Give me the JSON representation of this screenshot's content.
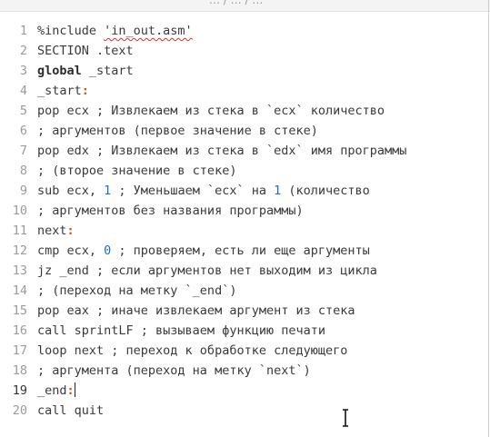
{
  "window": {
    "title_fragment": "… / … / …"
  },
  "editor": {
    "current_line": 19,
    "lines": [
      {
        "n": "1",
        "parts": [
          {
            "t": "%include ",
            "c": ""
          },
          {
            "t": "'in_out.asm'",
            "c": "str-under"
          }
        ]
      },
      {
        "n": "2",
        "parts": [
          {
            "t": "SECTION .text",
            "c": ""
          }
        ]
      },
      {
        "n": "3",
        "parts": [
          {
            "t": "global",
            "c": "kw"
          },
          {
            "t": " _start",
            "c": ""
          }
        ]
      },
      {
        "n": "4",
        "parts": [
          {
            "t": "_start",
            "c": ""
          },
          {
            "t": ":",
            "c": "lbl"
          }
        ]
      },
      {
        "n": "5",
        "parts": [
          {
            "t": "pop ecx ; Извлекаем из стека в `ecx` количество",
            "c": ""
          }
        ]
      },
      {
        "n": "6",
        "parts": [
          {
            "t": "; аргументов (первое значение в стеке)",
            "c": ""
          }
        ]
      },
      {
        "n": "7",
        "parts": [
          {
            "t": "pop edx ; Извлекаем из стека в `edx` имя программы",
            "c": ""
          }
        ]
      },
      {
        "n": "8",
        "parts": [
          {
            "t": "; (второе значение в стеке)",
            "c": ""
          }
        ]
      },
      {
        "n": "9",
        "parts": [
          {
            "t": "sub ecx, ",
            "c": ""
          },
          {
            "t": "1",
            "c": "num"
          },
          {
            "t": " ; Уменьшаем `ecx` на ",
            "c": ""
          },
          {
            "t": "1",
            "c": "num"
          },
          {
            "t": " (количество",
            "c": ""
          }
        ]
      },
      {
        "n": "10",
        "parts": [
          {
            "t": "; аргументов без названия программы)",
            "c": ""
          }
        ]
      },
      {
        "n": "11",
        "parts": [
          {
            "t": "next",
            "c": ""
          },
          {
            "t": ":",
            "c": "lbl"
          }
        ]
      },
      {
        "n": "12",
        "parts": [
          {
            "t": "cmp ecx, ",
            "c": ""
          },
          {
            "t": "0",
            "c": "num"
          },
          {
            "t": " ; проверяем, есть ли еще аргументы",
            "c": ""
          }
        ]
      },
      {
        "n": "13",
        "parts": [
          {
            "t": "jz _end ; если аргументов нет выходим из цикла",
            "c": ""
          }
        ]
      },
      {
        "n": "14",
        "parts": [
          {
            "t": "; (переход на метку `_end`)",
            "c": ""
          }
        ]
      },
      {
        "n": "15",
        "parts": [
          {
            "t": "pop eax ; иначе извлекаем аргумент из стека",
            "c": ""
          }
        ]
      },
      {
        "n": "16",
        "parts": [
          {
            "t": "call sprintLF ; вызываем функцию печати",
            "c": ""
          }
        ]
      },
      {
        "n": "17",
        "parts": [
          {
            "t": "loop next ; переход к обработке следующего",
            "c": ""
          }
        ]
      },
      {
        "n": "18",
        "parts": [
          {
            "t": "; аргумента (переход на метку `next`)",
            "c": ""
          }
        ]
      },
      {
        "n": "19",
        "parts": [
          {
            "t": "_end",
            "c": ""
          },
          {
            "t": ":",
            "c": "lbl"
          }
        ]
      },
      {
        "n": "20",
        "parts": [
          {
            "t": "call quit",
            "c": ""
          }
        ]
      }
    ]
  },
  "pointer": {
    "icon": "text-ibeam-cursor-icon"
  }
}
